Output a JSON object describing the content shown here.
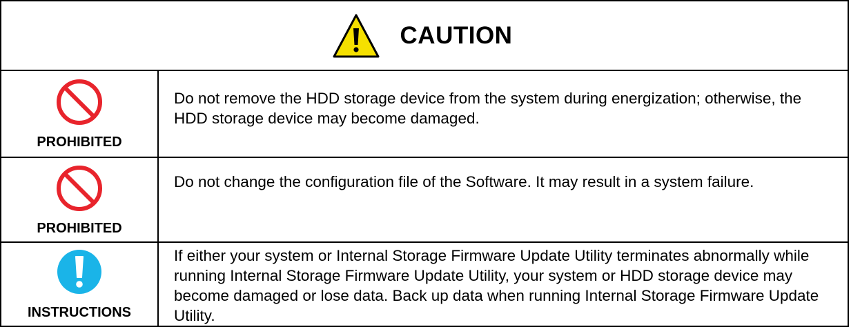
{
  "header": {
    "title": "CAUTION",
    "icon": "warning-triangle-icon",
    "icon_colors": {
      "fill": "#f5e000",
      "border": "#000000",
      "mark": "#000000"
    }
  },
  "rows": [
    {
      "icon": "prohibited-icon",
      "icon_color": "#e8242c",
      "label": "PROHIBITED",
      "text": "Do not remove the HDD storage device from the system during energization; otherwise, the HDD storage device may become damaged."
    },
    {
      "icon": "prohibited-icon",
      "icon_color": "#e8242c",
      "label": "PROHIBITED",
      "text": "Do not change the configuration file of the Software. It may result in a system failure."
    },
    {
      "icon": "exclamation-icon",
      "icon_color": "#1ab4e8",
      "label": "INSTRUCTIONS",
      "text": "If either your system or Internal Storage Firmware Update Utility terminates abnormally while running Internal Storage Firmware Update Utility, your system or HDD storage device may become damaged or lose data. Back up data when running Internal Storage Firmware Update Utility."
    }
  ]
}
